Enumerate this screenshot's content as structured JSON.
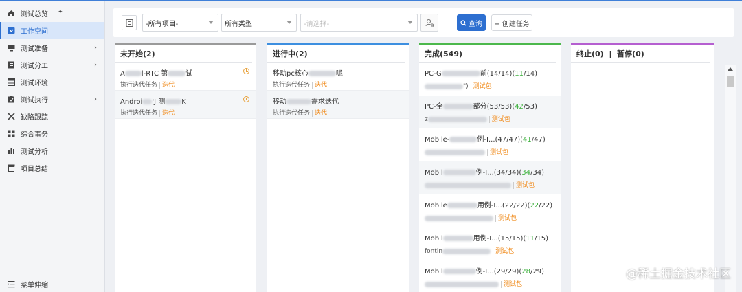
{
  "sidebar": {
    "items": [
      {
        "label": "测试总览",
        "icon": "home-icon",
        "pinned": true
      },
      {
        "label": "工作空间",
        "icon": "workspace-icon",
        "active": true
      },
      {
        "label": "测试准备",
        "icon": "monitor-icon",
        "expandable": true
      },
      {
        "label": "测试分工",
        "icon": "document-icon",
        "expandable": true
      },
      {
        "label": "测试环境",
        "icon": "table-icon"
      },
      {
        "label": "测试执行",
        "icon": "clipboard-icon",
        "expandable": true
      },
      {
        "label": "缺陷跟踪",
        "icon": "tools-icon"
      },
      {
        "label": "综合事务",
        "icon": "grid-icon"
      },
      {
        "label": "测试分析",
        "icon": "bar-chart-icon"
      },
      {
        "label": "项目总结",
        "icon": "archive-icon"
      }
    ],
    "collapse_label": "菜单伸缩"
  },
  "toolbar": {
    "project_select": "-所有项目-",
    "type_select": "所有类型",
    "choose_placeholder": "-请选择-",
    "query_label": "查询",
    "create_label": "+ 创建任务"
  },
  "columns": {
    "not_started": {
      "header": "未开始(2)",
      "accent": "#9a9a9a",
      "cards": [
        {
          "title_prefix": "A",
          "title_mid": "l-RTC 第",
          "title_suffix": "试",
          "type": "执行迭代任务",
          "tag": "迭代"
        },
        {
          "title_prefix": "Androi",
          "title_mid": "'J 测",
          "title_suffix": "K",
          "type": "执行迭代任务",
          "tag": "迭代"
        }
      ]
    },
    "in_progress": {
      "header": "进行中(2)",
      "accent": "#3d8fe0",
      "cards": [
        {
          "title_prefix": "移动pc核心",
          "title_suffix": "呢",
          "type": "执行迭代任务",
          "tag": "迭代"
        },
        {
          "title_prefix": "移动",
          "title_suffix": "需求迭代",
          "type": "执行迭代任务",
          "tag": "迭代"
        }
      ]
    },
    "done": {
      "header": "完成(549)",
      "accent": "#4cb84c",
      "cards": [
        {
          "title_prefix": "PC-G",
          "title_suffix": "前(14/14)(",
          "green": "11",
          "title_end": "/14)",
          "sub_text": "\")",
          "tag": "测试包"
        },
        {
          "title_prefix": "PC-全",
          "title_suffix": "部分(53/53)(",
          "green": "42",
          "title_end": "/53)",
          "sub_text": "z",
          "tag": "测试包"
        },
        {
          "title_prefix": "Mobile-",
          "title_suffix": "例-I...(47/47)(",
          "green": "41",
          "title_end": "/47)",
          "sub_text": "",
          "tag": "测试包"
        },
        {
          "title_prefix": "Mobil",
          "title_suffix": "例-I...(34/34)(",
          "green": "34",
          "title_end": "/34)",
          "sub_text": "",
          "tag": "测试包"
        },
        {
          "title_prefix": "Mobile",
          "title_suffix": "用例-I...(22/22)(",
          "green": "22",
          "title_end": "/22)",
          "sub_text": "",
          "tag": "测试包"
        },
        {
          "title_prefix": "Mobil",
          "title_suffix": "用例-I...(15/15)(",
          "green": "11",
          "title_end": "/15)",
          "sub_text": "fontin",
          "tag": "测试包"
        },
        {
          "title_prefix": "Mobil",
          "title_suffix": "例-I...(29/29)(",
          "green": "28",
          "title_end": "/29)",
          "sub_text": "",
          "tag": "测试包"
        }
      ]
    },
    "stopped": {
      "header": "终止(0)  |  暂停(0)",
      "accent": "#b55fd0"
    }
  },
  "watermark": "@稀土掘金技术社区"
}
